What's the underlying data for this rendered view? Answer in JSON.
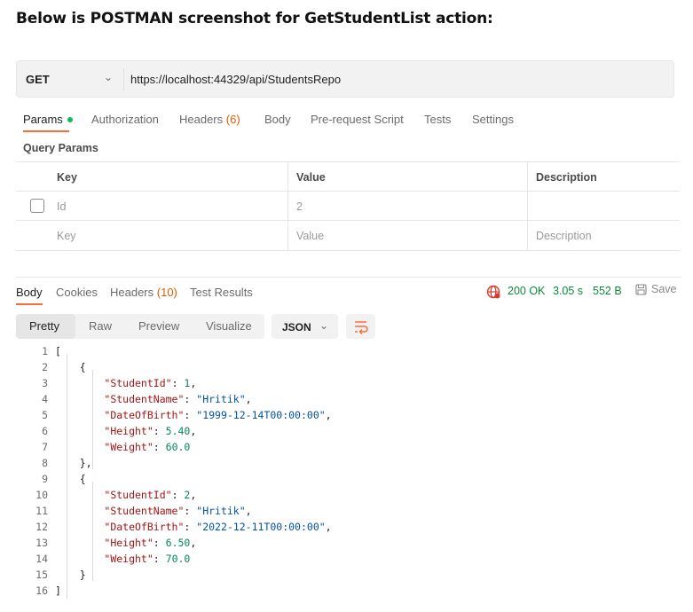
{
  "heading": "Below is POSTMAN screenshot for GetStudentList action:",
  "request": {
    "method": "GET",
    "url": "https://localhost:44329/api/StudentsRepo"
  },
  "request_tabs": {
    "params": "Params",
    "authorization": "Authorization",
    "headers": "Headers",
    "headers_count": "(6)",
    "body": "Body",
    "prerequest": "Pre-request Script",
    "tests": "Tests",
    "settings": "Settings"
  },
  "query_params": {
    "title": "Query Params",
    "columns": {
      "key": "Key",
      "value": "Value",
      "description": "Description"
    },
    "rows": [
      {
        "key": "Id",
        "value": "2",
        "description": ""
      }
    ],
    "placeholder": {
      "key": "Key",
      "value": "Value",
      "description": "Description"
    }
  },
  "response_tabs": {
    "body": "Body",
    "cookies": "Cookies",
    "headers": "Headers",
    "headers_count": "(10)",
    "test_results": "Test Results"
  },
  "response_status": {
    "status": "200 OK",
    "time": "3.05 s",
    "size": "552 B",
    "save": "Save",
    "status_color": "#0b8a3a"
  },
  "format_tabs": {
    "pretty": "Pretty",
    "raw": "Raw",
    "preview": "Preview",
    "visualize": "Visualize",
    "language": "JSON"
  },
  "code_lines": [
    {
      "n": "1",
      "text": "["
    },
    {
      "n": "2",
      "text": "    {"
    },
    {
      "n": "3",
      "key": "\"StudentId\"",
      "val": "1",
      "vtype": "num",
      "comma": ","
    },
    {
      "n": "4",
      "key": "\"StudentName\"",
      "val": "\"Hritik\"",
      "vtype": "str",
      "comma": ","
    },
    {
      "n": "5",
      "key": "\"DateOfBirth\"",
      "val": "\"1999-12-14T00:00:00\"",
      "vtype": "str",
      "comma": ","
    },
    {
      "n": "6",
      "key": "\"Height\"",
      "val": "5.40",
      "vtype": "num",
      "comma": ","
    },
    {
      "n": "7",
      "key": "\"Weight\"",
      "val": "60.0",
      "vtype": "num",
      "comma": ""
    },
    {
      "n": "8",
      "text": "    },"
    },
    {
      "n": "9",
      "text": "    {"
    },
    {
      "n": "10",
      "key": "\"StudentId\"",
      "val": "2",
      "vtype": "num",
      "comma": ","
    },
    {
      "n": "11",
      "key": "\"StudentName\"",
      "val": "\"Hritik\"",
      "vtype": "str",
      "comma": ","
    },
    {
      "n": "12",
      "key": "\"DateOfBirth\"",
      "val": "\"2022-12-11T00:00:00\"",
      "vtype": "str",
      "comma": ","
    },
    {
      "n": "13",
      "key": "\"Height\"",
      "val": "6.50",
      "vtype": "num",
      "comma": ","
    },
    {
      "n": "14",
      "key": "\"Weight\"",
      "val": "70.0",
      "vtype": "num",
      "comma": ""
    },
    {
      "n": "15",
      "text": "    }"
    },
    {
      "n": "16",
      "text": "]"
    }
  ]
}
